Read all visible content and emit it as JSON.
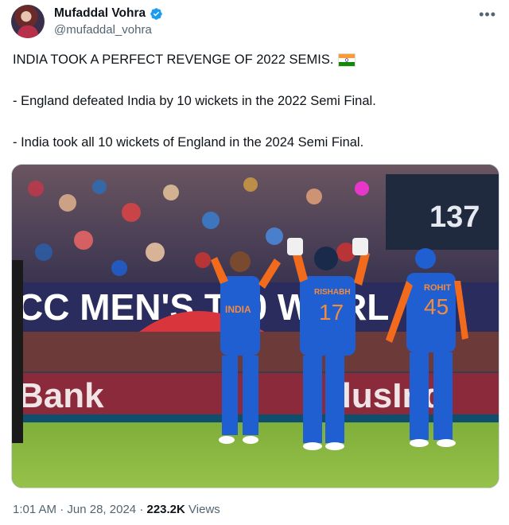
{
  "author": {
    "display_name": "Mufaddal Vohra",
    "handle": "@mufaddal_vohra",
    "verified": true
  },
  "tweet": {
    "line1": "INDIA TOOK A PERFECT REVENGE OF 2022 SEMIS.",
    "line2": "- England defeated India by 10 wickets in the 2022 Semi Final.",
    "line3": "- India took all 10 wickets of England in the 2024 Semi Final."
  },
  "media": {
    "scoreboard": "137",
    "banner": "CC MEN'S T20 WORL",
    "ad_left": "Bank",
    "ad_right": "dusInd",
    "jersey_chest": "INDIA",
    "player_center_name": "RISHABH",
    "player_center_number": "17",
    "player_right_name": "ROHIT",
    "player_right_number": "45"
  },
  "meta": {
    "time": "1:01 AM",
    "sep": "·",
    "date": "Jun 28, 2024",
    "views_count": "223.2K",
    "views_label": "Views"
  },
  "icons": {
    "verified": "verified-badge-icon",
    "more": "more-options-icon",
    "flag": "india-flag-emoji"
  },
  "colors": {
    "verified_blue": "#1d9bf0",
    "secondary_text": "#536471",
    "india_blue": "#1f5fd1",
    "india_orange": "#f26b1d"
  }
}
